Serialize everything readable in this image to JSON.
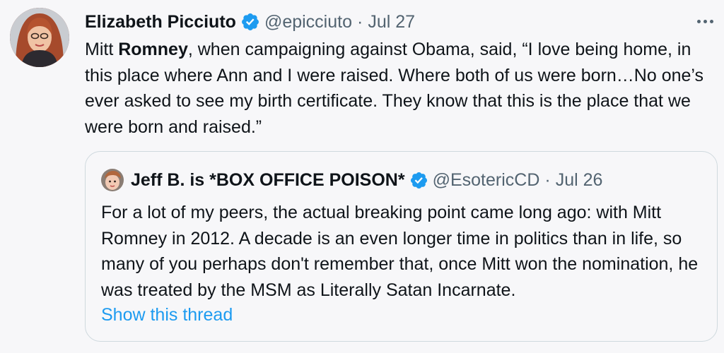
{
  "tweet": {
    "author_name": "Elizabeth Picciuto",
    "author_handle": "@epicciuto",
    "separator": "·",
    "date": "Jul 27",
    "text_before_bold": "Mitt ",
    "text_bold": "Romney",
    "text_after_bold": ", when campaigning against Obama, said, “I love being home, in this place where Ann and I were raised. Where both of us were born…No one’s ever asked to see my birth certificate. They know that this is the place that we were born and raised.”",
    "avatar_icon": "profile-photo-icon",
    "more_icon": "more-options-icon",
    "verified_icon": "verified-badge-icon"
  },
  "quoted": {
    "author_name": "Jeff B. is *BOX OFFICE POISON*",
    "author_handle": "@EsotericCD",
    "separator": "·",
    "date": "Jul 26",
    "text": "For a lot of my peers, the actual breaking point came long ago: with Mitt Romney in 2012. A decade is an even longer time in politics than in life, so many of you perhaps don't remember that, once Mitt won the nomination, he was treated by the MSM as Literally Satan Incarnate.",
    "show_thread": "Show this thread"
  },
  "colors": {
    "background": "#f7f7f9",
    "text": "#0f1419",
    "muted": "#536471",
    "link": "#1d9bf0",
    "verified": "#1d9bf0",
    "border": "#cfd9de"
  }
}
